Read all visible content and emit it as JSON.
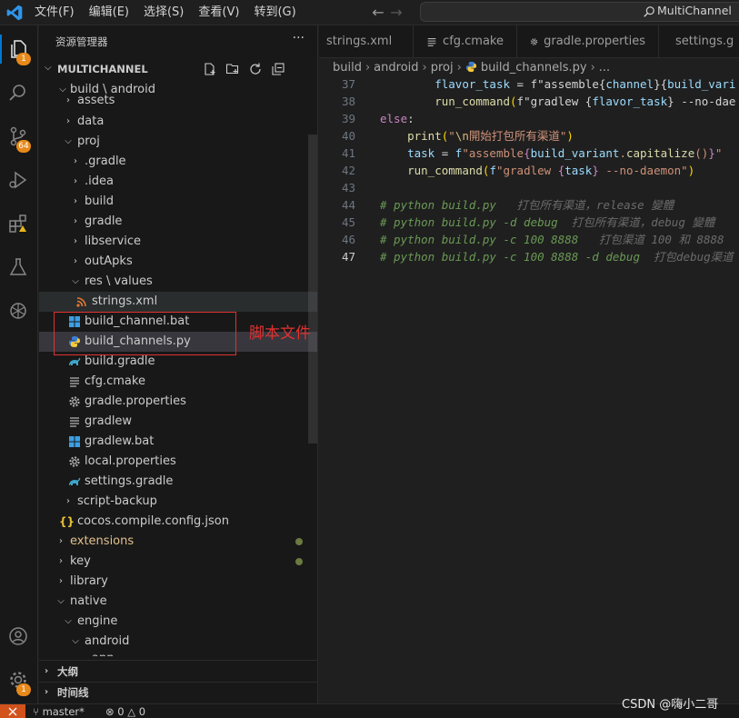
{
  "menu": [
    "文件(F)",
    "编辑(E)",
    "选择(S)",
    "查看(V)",
    "转到(G)"
  ],
  "nav": {
    "back": "←",
    "forward": "→"
  },
  "search": {
    "text": "MultiChannel"
  },
  "activity_badges": {
    "explorer": "1",
    "scm": "64",
    "accounts": "1"
  },
  "sidebar": {
    "header": "资源管理器",
    "more": "···",
    "project": "MULTICHANNEL",
    "tree": [
      {
        "label": "build \\ android",
        "chevron": "v"
      },
      {
        "label": "assets",
        "chevron": ">"
      },
      {
        "label": "data",
        "chevron": ">"
      },
      {
        "label": "proj",
        "chevron": "v"
      },
      {
        "label": ".gradle",
        "chevron": ">"
      },
      {
        "label": ".idea",
        "chevron": ">"
      },
      {
        "label": "build",
        "chevron": ">"
      },
      {
        "label": "gradle",
        "chevron": ">"
      },
      {
        "label": "libservice",
        "chevron": ">"
      },
      {
        "label": "outApks",
        "chevron": ">"
      },
      {
        "label": "res \\ values",
        "chevron": "v"
      },
      {
        "label": "strings.xml",
        "icon": "rss-icon"
      },
      {
        "label": "build_channel.bat",
        "icon": "windows-icon"
      },
      {
        "label": "build_channels.py",
        "icon": "python-icon"
      },
      {
        "label": "build.gradle",
        "icon": "gradle-icon"
      },
      {
        "label": "cfg.cmake",
        "icon": "lines-icon"
      },
      {
        "label": "gradle.properties",
        "icon": "gear-icon"
      },
      {
        "label": "gradlew",
        "icon": "lines-icon"
      },
      {
        "label": "gradlew.bat",
        "icon": "windows-icon"
      },
      {
        "label": "local.properties",
        "icon": "gear-icon"
      },
      {
        "label": "settings.gradle",
        "icon": "gradle-icon"
      },
      {
        "label": "script-backup",
        "chevron": ">"
      },
      {
        "label": "cocos.compile.config.json",
        "icon": "json-icon"
      },
      {
        "label": "extensions",
        "chevron": ">"
      },
      {
        "label": "key",
        "chevron": ">"
      },
      {
        "label": "library",
        "chevron": ">"
      },
      {
        "label": "native",
        "chevron": "v"
      },
      {
        "label": "engine",
        "chevron": "v"
      },
      {
        "label": "android",
        "chevron": ">"
      },
      {
        "label": "app",
        "chevron": "v"
      }
    ],
    "panels": [
      "大纲",
      "时间线"
    ]
  },
  "annotation": {
    "text": "脚本文件",
    "color": "#e03131"
  },
  "tabs": [
    "strings.xml",
    "cfg.cmake",
    "gradle.properties",
    "settings.g"
  ],
  "breadcrumbs": [
    "build",
    "android",
    "proj",
    "build_channels.py",
    "..."
  ],
  "code": {
    "line_numbers": [
      "37",
      "38",
      "39",
      "40",
      "41",
      "42",
      "43",
      "44",
      "45",
      "46",
      "47"
    ],
    "lines": [
      "        flavor_task = f\"assemble{channel}{build_vari",
      "        run_command(f\"gradlew {flavor_task} --no-dae",
      "else:",
      "    print(\"\\n開始打包所有渠道\")",
      "    task = f\"assemble{build_variant.capitalize()}\"",
      "    run_command(f\"gradlew {task} --no-daemon\")",
      "",
      "# python build.py   打包所有渠道，release 變體",
      "# python build.py -d debug  打包所有渠道，debug 變體",
      "# python build.py -c 100 8888   打包渠道 100 和 8888",
      "# python build.py -c 100 8888 -d debug  打包debug渠道"
    ]
  },
  "status": {
    "branch": "master*",
    "errors": "0",
    "warnings": "0"
  },
  "watermark": "CSDN @嗨小二哥",
  "colors": {
    "accent": "#0078d4",
    "badge": "#e8891a",
    "annotation": "#e03131",
    "remote": "#d1521c"
  }
}
